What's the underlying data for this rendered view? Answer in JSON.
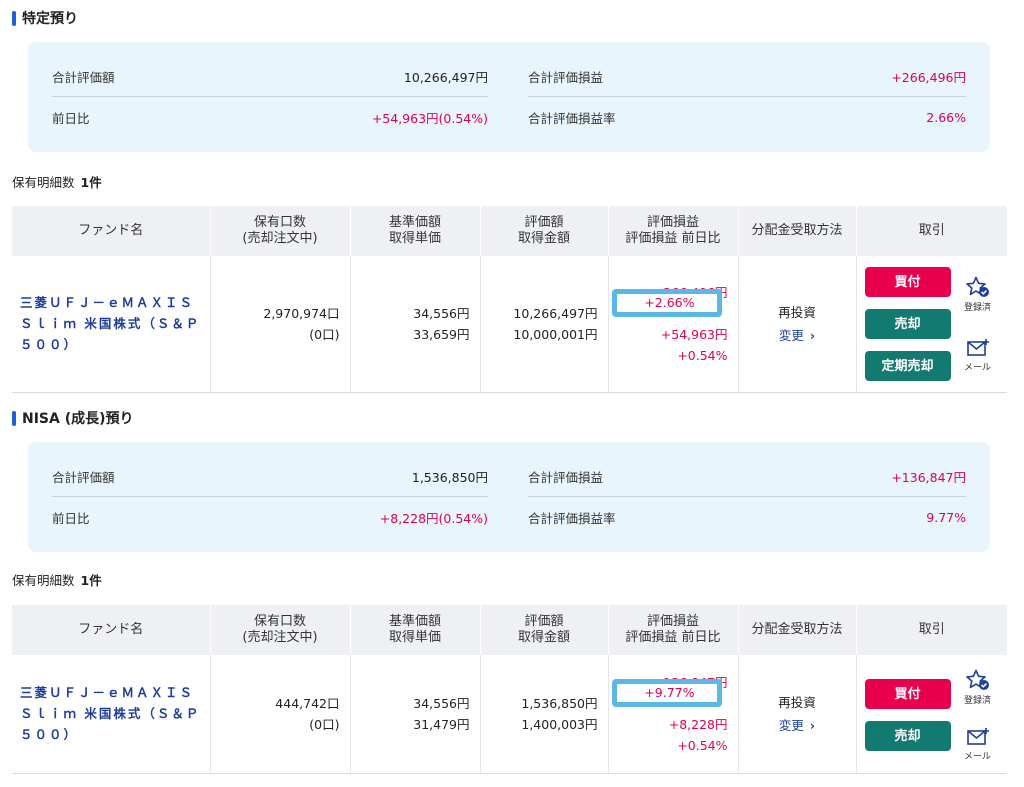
{
  "sections": [
    {
      "title": "特定預り",
      "summary": {
        "total_value_label": "合計評価額",
        "total_value": "10,266,497円",
        "total_pl_label": "合計評価損益",
        "total_pl": "+266,496円",
        "day_change_label": "前日比",
        "day_change": "+54,963円(0.54%)",
        "pl_rate_label": "合計評価損益率",
        "pl_rate": "2.66%"
      },
      "count_label": "保有明細数",
      "count_value": "1件",
      "holding": {
        "fund_name": "三菱ＵＦＪ－ｅＭＡＸＩＳ Ｓｌｉｍ 米国株式（Ｓ＆Ｐ５００）",
        "units": "2,970,974口",
        "units_pending": "(0口)",
        "nav": "34,556円",
        "acq_unit": "33,659円",
        "value": "10,266,497円",
        "acq_amount": "10,000,001円",
        "pl": "+266,496円",
        "pl_pct": "+2.66%",
        "pl_day": "+54,963円",
        "pl_day_pct": "+0.54%",
        "method": "再投資",
        "change": "変更",
        "buy": "買付",
        "sell": "売却",
        "regular_sell": "定期売却",
        "registered": "登録済",
        "mail": "メール"
      }
    },
    {
      "title": "NISA (成長)預り",
      "summary": {
        "total_value_label": "合計評価額",
        "total_value": "1,536,850円",
        "total_pl_label": "合計評価損益",
        "total_pl": "+136,847円",
        "day_change_label": "前日比",
        "day_change": "+8,228円(0.54%)",
        "pl_rate_label": "合計評価損益率",
        "pl_rate": "9.77%"
      },
      "count_label": "保有明細数",
      "count_value": "1件",
      "holding": {
        "fund_name": "三菱ＵＦＪ－ｅＭＡＸＩＳ Ｓｌｉｍ 米国株式（Ｓ＆Ｐ５００）",
        "units": "444,742口",
        "units_pending": "(0口)",
        "nav": "34,556円",
        "acq_unit": "31,479円",
        "value": "1,536,850円",
        "acq_amount": "1,400,003円",
        "pl": "+136,847円",
        "pl_pct": "+9.77%",
        "pl_day": "+8,228円",
        "pl_day_pct": "+0.54%",
        "method": "再投資",
        "change": "変更",
        "buy": "買付",
        "sell": "売却",
        "registered": "登録済",
        "mail": "メール"
      }
    }
  ],
  "table_headers": {
    "fund": "ファンド名",
    "units_1": "保有口数",
    "units_2": "(売却注文中)",
    "nav_1": "基準価額",
    "nav_2": "取得単価",
    "value_1": "評価額",
    "value_2": "取得金額",
    "pl_1": "評価損益",
    "pl_2": "評価損益 前日比",
    "method": "分配金受取方法",
    "trade": "取引"
  },
  "colors": {
    "accent_blue": "#1e60d8",
    "gain_red": "#e2004d",
    "buy_button": "#e8004f",
    "sell_button": "#127a70",
    "summary_bg": "#e8f5fc",
    "highlight_box": "#5bb8e6"
  },
  "icons": {
    "registered": "star-check-icon",
    "mail": "mail-plus-icon",
    "change": "chevron-right-icon"
  }
}
